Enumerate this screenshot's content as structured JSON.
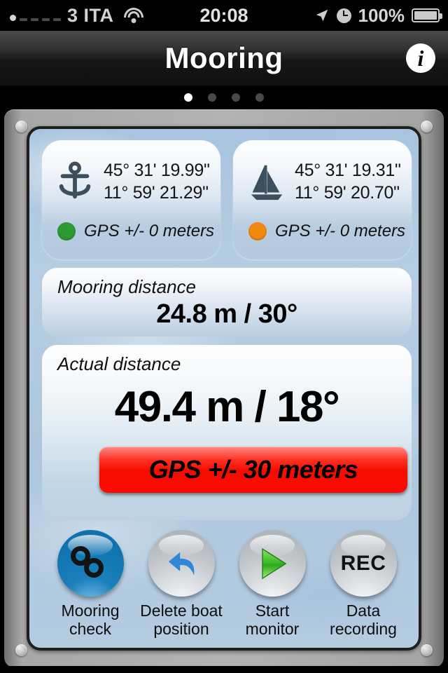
{
  "status_bar": {
    "carrier": "3 ITA",
    "time": "20:08",
    "battery_percent": "100%",
    "icons": [
      "signal-bars-icon",
      "wifi-icon",
      "location-arrow-icon",
      "alarm-clock-icon",
      "battery-icon"
    ]
  },
  "nav": {
    "title": "Mooring",
    "info_label": "i"
  },
  "page_dots": {
    "count": 4,
    "active_index": 0
  },
  "anchor_panel": {
    "icon": "anchor-icon",
    "latitude": "45° 31' 19.99\"",
    "longitude": "11° 59' 21.29\"",
    "gps_status": "GPS +/- 0 meters",
    "dot_color": "#2d9b34"
  },
  "boat_panel": {
    "icon": "sailboat-icon",
    "latitude": "45° 31' 19.31\"",
    "longitude": "11° 59' 20.70\"",
    "gps_status": "GPS +/- 0 meters",
    "dot_color": "#ef8b12"
  },
  "mooring_distance": {
    "label": "Mooring distance",
    "value": "24.8 m / 30°"
  },
  "actual_distance": {
    "label": "Actual distance",
    "value": "49.4 m / 18°"
  },
  "gps_alert": {
    "text": "GPS +/- 30 meters",
    "color": "#f40c00"
  },
  "toolbar": [
    {
      "name": "mooring-check",
      "label": "Mooring\ncheck",
      "icon": "chain-link-icon",
      "style": "blue"
    },
    {
      "name": "delete-boat-position",
      "label": "Delete boat\nposition",
      "icon": "undo-arrow-icon",
      "style": "gray"
    },
    {
      "name": "start-monitor",
      "label": "Start monitor",
      "icon": "play-icon",
      "style": "gray"
    },
    {
      "name": "data-recording",
      "label": "Data\nrecording",
      "icon": "rec-icon",
      "style": "gray",
      "icon_text": "REC"
    }
  ]
}
